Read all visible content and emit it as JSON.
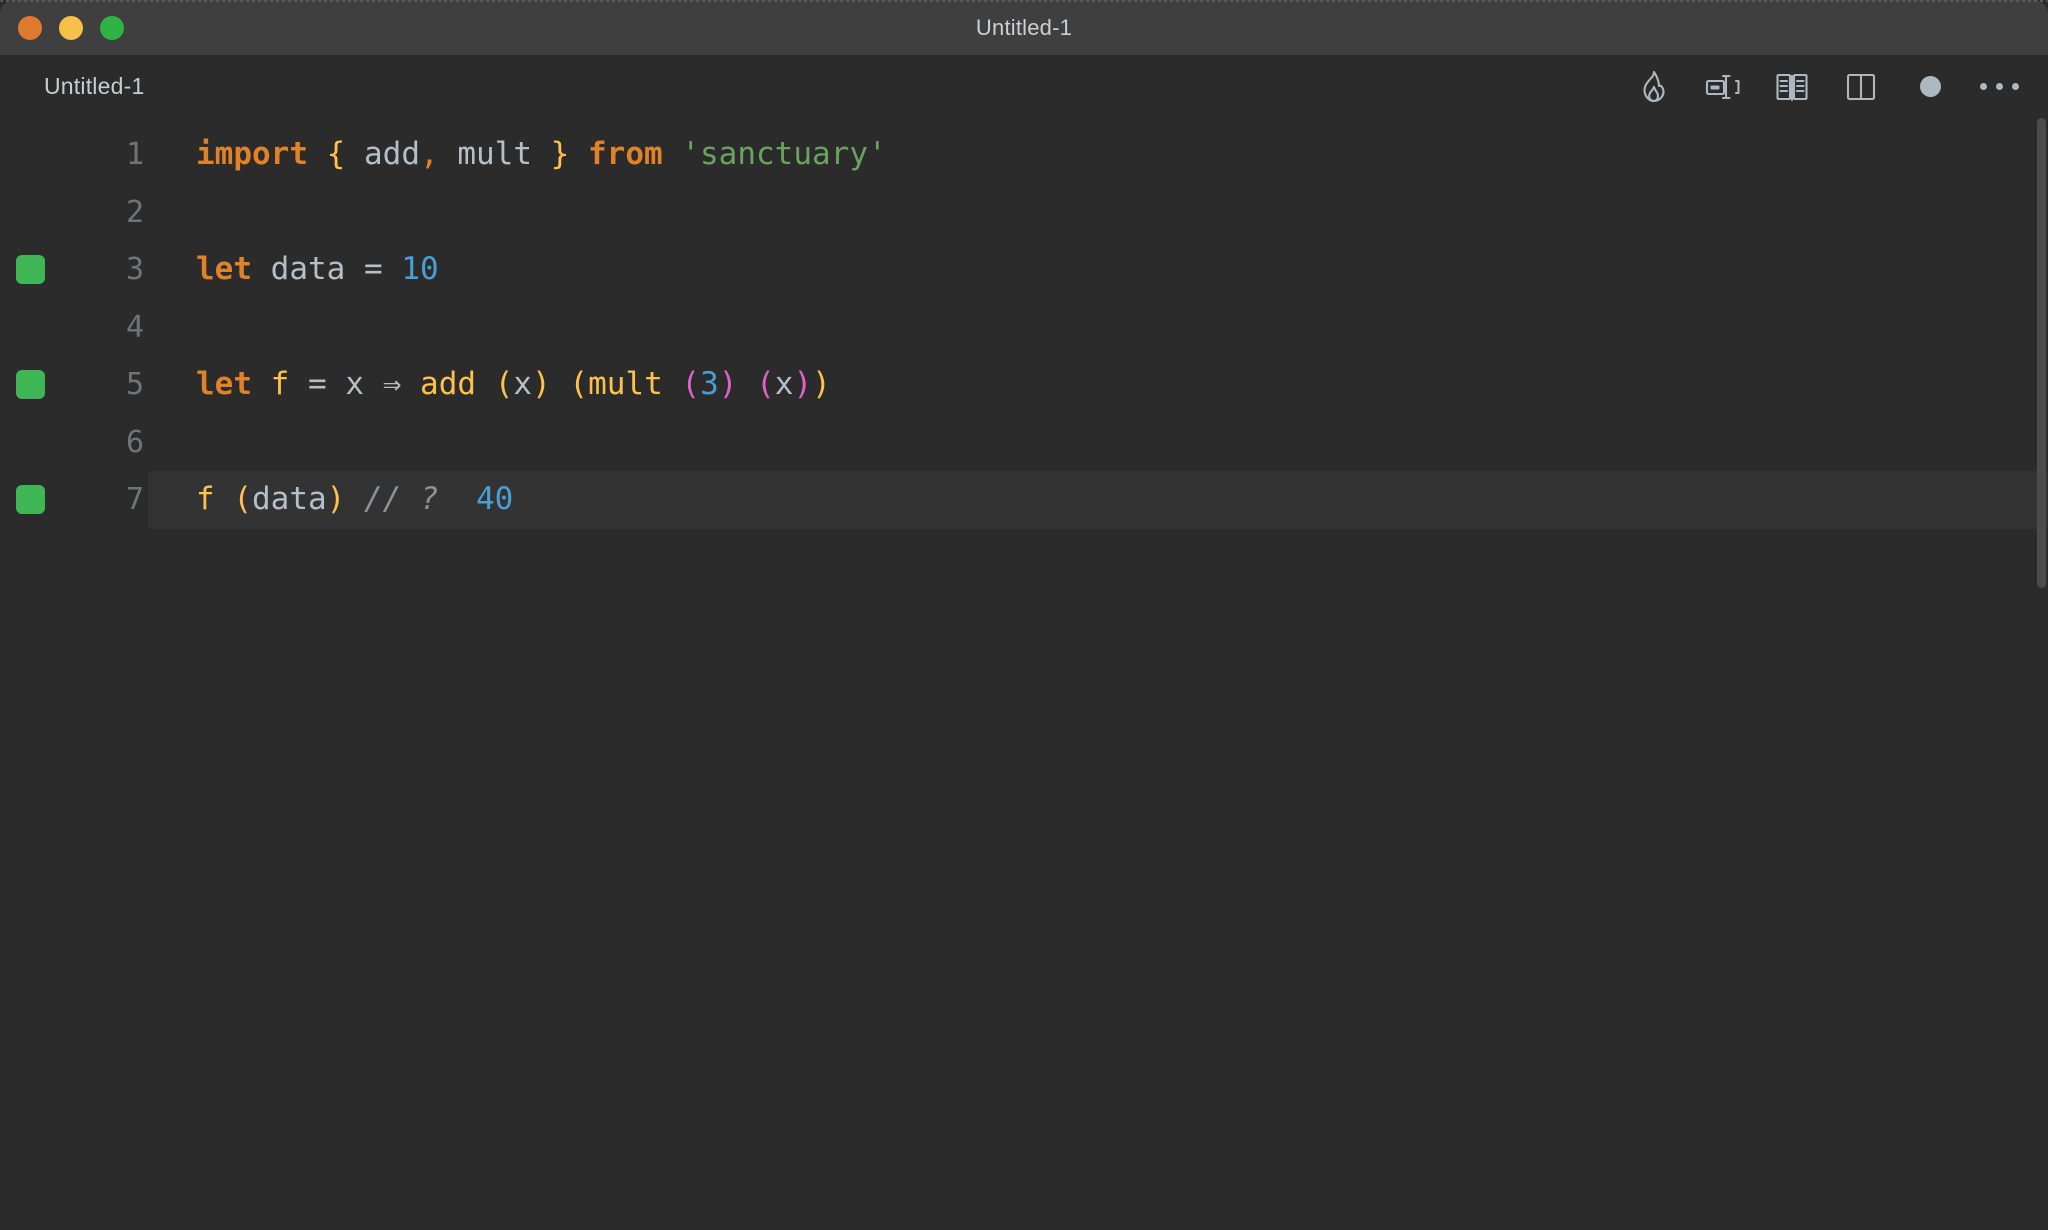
{
  "window": {
    "title": "Untitled-1",
    "controls": [
      {
        "name": "close",
        "color": "#e07a2f"
      },
      {
        "name": "minimize",
        "color": "#f7c04a"
      },
      {
        "name": "maximize",
        "color": "#2fb344"
      }
    ]
  },
  "tabstrip": {
    "tab_label": "Untitled-1",
    "toolbar": [
      {
        "icon": "flame-icon",
        "label": "Run / Execute"
      },
      {
        "icon": "rename-icon",
        "label": "Rename"
      },
      {
        "icon": "open-book-icon",
        "label": "Documentation"
      },
      {
        "icon": "split-editor-icon",
        "label": "Split Editor"
      },
      {
        "icon": "unsaved-dot-icon",
        "label": "Unsaved changes"
      },
      {
        "icon": "ellipsis-icon",
        "label": "More actions"
      }
    ]
  },
  "editor": {
    "active_line": 7,
    "lines": [
      {
        "number": "1",
        "marker": false,
        "tokens": [
          {
            "text": "import",
            "type": "kw"
          },
          {
            "text": " ",
            "type": "plain"
          },
          {
            "text": "{",
            "type": "br1"
          },
          {
            "text": " ",
            "type": "plain"
          },
          {
            "text": "add",
            "type": "id"
          },
          {
            "text": ",",
            "type": "punc"
          },
          {
            "text": " ",
            "type": "plain"
          },
          {
            "text": "mult",
            "type": "id"
          },
          {
            "text": " ",
            "type": "plain"
          },
          {
            "text": "}",
            "type": "br1"
          },
          {
            "text": " ",
            "type": "plain"
          },
          {
            "text": "from",
            "type": "kw"
          },
          {
            "text": " ",
            "type": "plain"
          },
          {
            "text": "'sanctuary'",
            "type": "str"
          }
        ]
      },
      {
        "number": "2",
        "marker": false,
        "tokens": []
      },
      {
        "number": "3",
        "marker": true,
        "tokens": [
          {
            "text": "let",
            "type": "kw"
          },
          {
            "text": " ",
            "type": "plain"
          },
          {
            "text": "data",
            "type": "id"
          },
          {
            "text": " ",
            "type": "plain"
          },
          {
            "text": "=",
            "type": "op"
          },
          {
            "text": " ",
            "type": "plain"
          },
          {
            "text": "10",
            "type": "num"
          }
        ]
      },
      {
        "number": "4",
        "marker": false,
        "tokens": []
      },
      {
        "number": "5",
        "marker": true,
        "tokens": [
          {
            "text": "let",
            "type": "kw"
          },
          {
            "text": " ",
            "type": "plain"
          },
          {
            "text": "f",
            "type": "fn"
          },
          {
            "text": " ",
            "type": "plain"
          },
          {
            "text": "=",
            "type": "op"
          },
          {
            "text": " ",
            "type": "plain"
          },
          {
            "text": "x",
            "type": "id"
          },
          {
            "text": " ",
            "type": "plain"
          },
          {
            "text": "⇒",
            "type": "op"
          },
          {
            "text": " ",
            "type": "plain"
          },
          {
            "text": "add",
            "type": "fn"
          },
          {
            "text": " ",
            "type": "plain"
          },
          {
            "text": "(",
            "type": "br1"
          },
          {
            "text": "x",
            "type": "id"
          },
          {
            "text": ")",
            "type": "br1"
          },
          {
            "text": " ",
            "type": "plain"
          },
          {
            "text": "(",
            "type": "br1"
          },
          {
            "text": "mult",
            "type": "fn"
          },
          {
            "text": " ",
            "type": "plain"
          },
          {
            "text": "(",
            "type": "br2"
          },
          {
            "text": "3",
            "type": "num"
          },
          {
            "text": ")",
            "type": "br2"
          },
          {
            "text": " ",
            "type": "plain"
          },
          {
            "text": "(",
            "type": "br2"
          },
          {
            "text": "x",
            "type": "id"
          },
          {
            "text": ")",
            "type": "br2"
          },
          {
            "text": ")",
            "type": "br1"
          }
        ]
      },
      {
        "number": "6",
        "marker": false,
        "tokens": []
      },
      {
        "number": "7",
        "marker": true,
        "tokens": [
          {
            "text": "f",
            "type": "fn"
          },
          {
            "text": " ",
            "type": "plain"
          },
          {
            "text": "(",
            "type": "br1"
          },
          {
            "text": "data",
            "type": "id"
          },
          {
            "text": ")",
            "type": "br1"
          },
          {
            "text": " ",
            "type": "plain"
          },
          {
            "text": "// ?",
            "type": "comment"
          },
          {
            "text": "  ",
            "type": "plain"
          },
          {
            "text": "40",
            "type": "num"
          }
        ]
      }
    ]
  },
  "colors": {
    "editor_background": "#2b2b2b",
    "titlebar_background": "#3f3f3f",
    "active_line_background": "#333333",
    "gutter_marker": "#3eb653",
    "keyword": "#e08228",
    "function": "#ffc14d",
    "identifier": "#b3bfc9",
    "string": "#6aa35e",
    "number": "#4a9ed6",
    "bracket_level_2": "#e062c9",
    "comment": "#8b9298"
  }
}
